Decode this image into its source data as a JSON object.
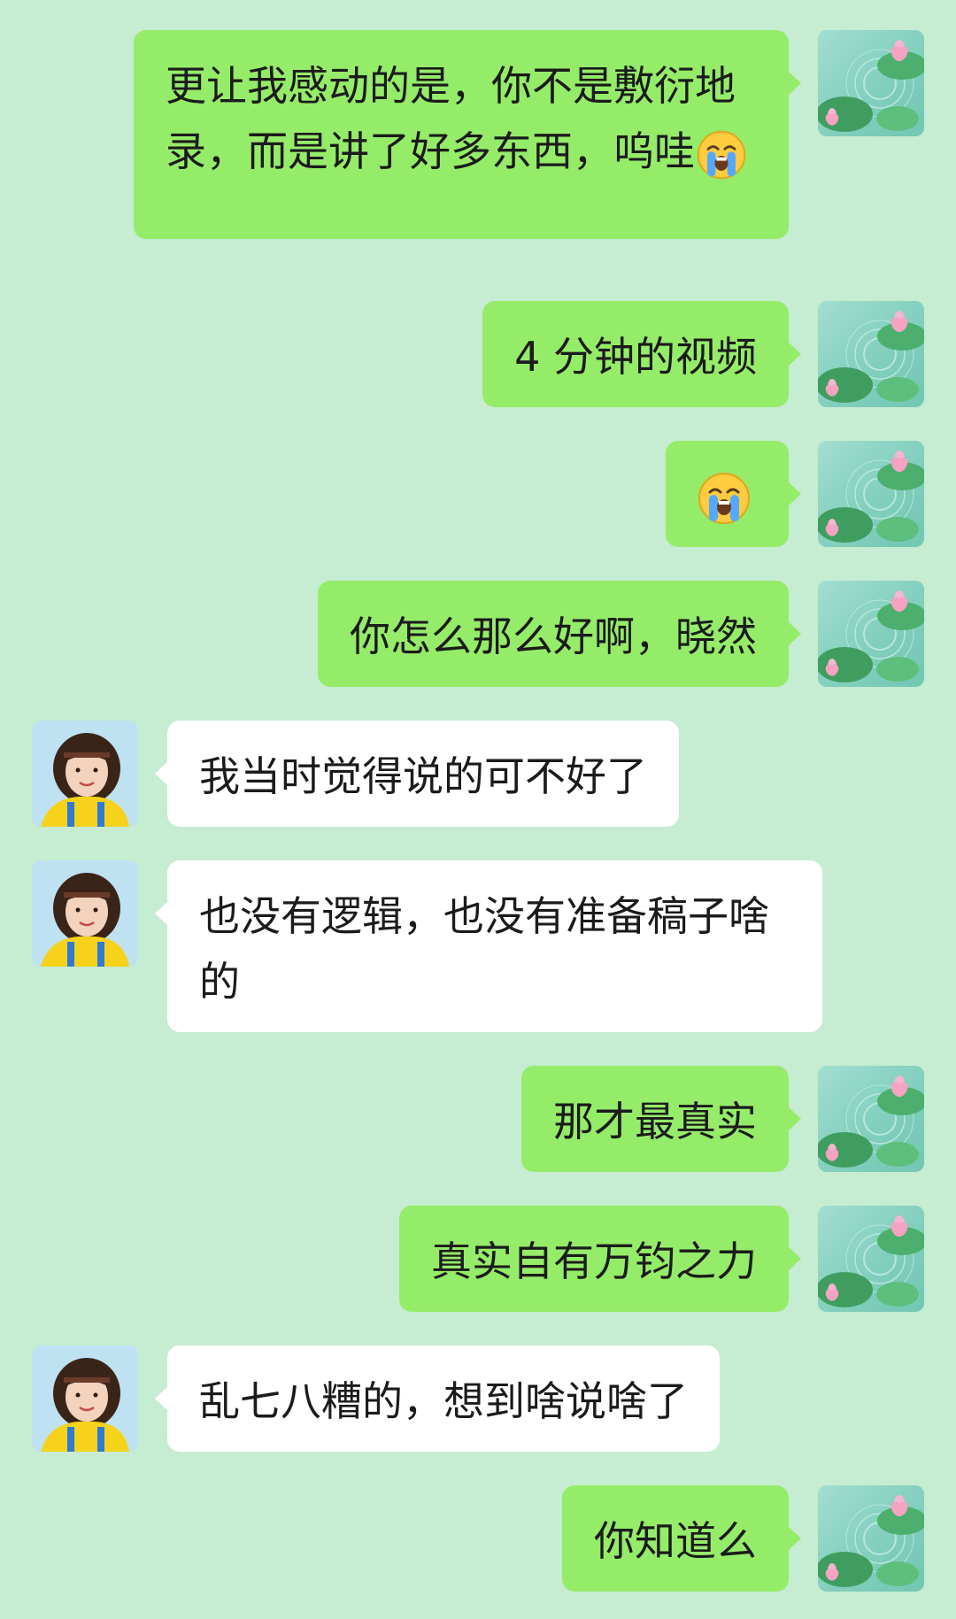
{
  "messages": [
    {
      "side": "me",
      "text": "更让我感动的是，你不是敷衍地录，而是讲了好多东西，呜哇",
      "emoji": "loudly-crying-face"
    },
    {
      "side": "me",
      "text": "4 分钟的视频"
    },
    {
      "side": "me",
      "text": "",
      "emoji": "loudly-crying-face"
    },
    {
      "side": "me",
      "text": "你怎么那么好啊，晓然"
    },
    {
      "side": "other",
      "text": "我当时觉得说的可不好了"
    },
    {
      "side": "other",
      "text": "也没有逻辑，也没有准备稿子啥的"
    },
    {
      "side": "me",
      "text": "那才最真实"
    },
    {
      "side": "me",
      "text": "真实自有万钧之力"
    },
    {
      "side": "other",
      "text": "乱七八糟的，想到啥说啥了"
    },
    {
      "side": "me",
      "text": "你知道么"
    }
  ],
  "avatars": {
    "me": "lotus-pond-avatar",
    "other": "girl-yellow-shirt-avatar"
  },
  "colors": {
    "background": "#c6ecd2",
    "my_bubble": "#95ec69",
    "other_bubble": "#ffffff"
  }
}
